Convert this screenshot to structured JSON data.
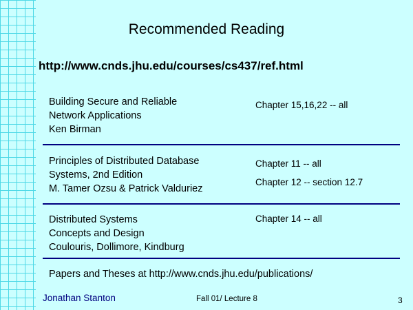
{
  "slide": {
    "title": "Recommended Reading",
    "url": "http://www.cnds.jhu.edu/courses/cs437/ref.html"
  },
  "books": [
    {
      "lines": [
        "Building Secure and Reliable",
        "Network Applications",
        "Ken Birman"
      ],
      "chapters": [
        "Chapter 15,16,22 -- all"
      ]
    },
    {
      "lines": [
        "Principles of Distributed Database",
        "Systems, 2nd Edition",
        "M. Tamer Ozsu & Patrick Valduriez"
      ],
      "chapters": [
        "Chapter 11 -- all",
        "Chapter 12  -- section 12.7"
      ]
    },
    {
      "lines": [
        "Distributed Systems",
        "Concepts and Design",
        "Coulouris, Dollimore, Kindburg"
      ],
      "chapters": [
        "Chapter 14 -- all"
      ]
    }
  ],
  "papers_note": "Papers and Theses at http://www.cnds.jhu.edu/publications/",
  "footer": {
    "author": "Jonathan Stanton",
    "course": "Fall 01/ Lecture 8",
    "page": "3"
  },
  "colors": {
    "background": "#ccffff",
    "grid": "#4dd8e6",
    "divider": "#000080",
    "author_text": "#000080"
  }
}
